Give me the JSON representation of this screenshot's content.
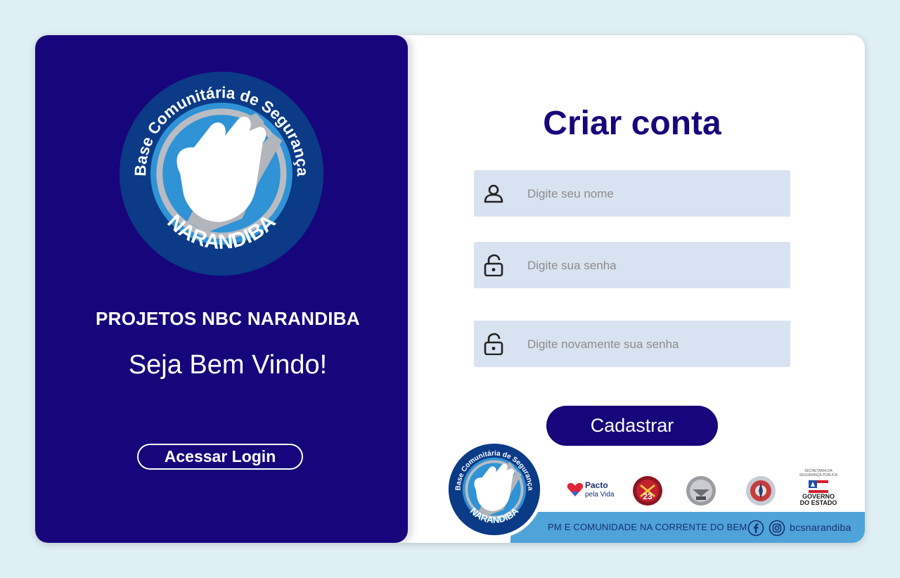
{
  "left_panel": {
    "logo": {
      "arc_top": "Base Comunitária de Segurança",
      "arc_bottom": "NARANDIBA"
    },
    "brand_title": "PROJETOS NBC NARANDIBA",
    "welcome": "Seja Bem Vindo!",
    "login_button": "Acessar Login"
  },
  "form": {
    "title": "Criar conta",
    "name_placeholder": "Digite seu nome",
    "password_placeholder": "Digite sua senha",
    "confirm_placeholder": "Digite novamente sua senha",
    "submit_label": "Cadastrar"
  },
  "footer": {
    "slogan": "PM E COMUNIDADE NA CORRENTE DO BEM",
    "handle": "bcsnarandiba",
    "partners": {
      "pacto_line1": "Pacto",
      "pacto_line2": "pela Vida",
      "badge_23": "23",
      "gov_line1": "GOVERNO",
      "gov_line2": "DO ESTADO",
      "sec_line": "SECRETARIA DA SEGURANÇA PÚBLICA"
    }
  },
  "colors": {
    "primary": "#17057c",
    "input_bg": "#d8e3f1",
    "page_bg": "#dff0f4",
    "accent_blue": "#4ea3d9"
  },
  "icons": {
    "name_field": "user-icon",
    "password_field": "unlock-icon",
    "confirm_field": "unlock-icon"
  }
}
